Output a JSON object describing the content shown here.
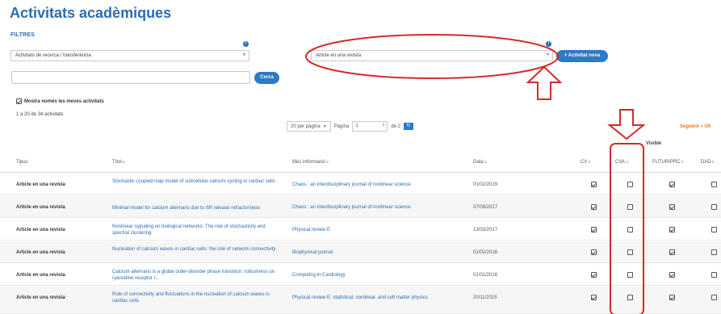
{
  "page": {
    "title": "Activitats acadèmiques",
    "filters_label": "FILTRES"
  },
  "filters": {
    "category_select": "Activitats de recerca / transferència",
    "subtype_select": "Article en una revista",
    "search_value": "",
    "search_button": "Cerca",
    "new_activity_button": "+ Activitat nova",
    "only_new_label": "Mostra només les meves activitats",
    "only_new_checked": true,
    "info_icon": "i"
  },
  "results": {
    "count_text": "1 a 20 de 34 activitats"
  },
  "pager": {
    "per_page": "20 per pàgina",
    "page_label": "Pàgina",
    "page_value": "1",
    "of_label": "de 2",
    "go_icon": "↻",
    "next_link": "Següent » Últ"
  },
  "table": {
    "visible_label": "Visible",
    "headers": {
      "tipus": "Tipus",
      "titol": "Títol",
      "info": "Més informació",
      "data": "Data",
      "cv": "CV",
      "cva": "CVA",
      "futur": "FUTUR/PRC",
      "dad": "DAD"
    },
    "rows": [
      {
        "type": "Article en una revista",
        "title": "Stochastic coupled map model of subcellular calcium cycling in cardiac cells",
        "info": "Chaos : an interdisciplinary journal of nonlinear science",
        "date": "01/02/2019",
        "cv": true,
        "cva": false,
        "futur": true,
        "dad": false
      },
      {
        "type": "Article en una revista",
        "title": "Minimal model for calcium alternans due to SR release refractoriness",
        "info": "Chaos : an interdisciplinary journal of nonlinear science",
        "date": "07/09/2017",
        "cv": true,
        "cva": false,
        "futur": true,
        "dad": false
      },
      {
        "type": "Article en una revista",
        "title": "Nonlinear signaling on biological networks: The role of stochasticity and spectral clustering",
        "info": "Physical review E",
        "date": "13/03/2017",
        "cv": true,
        "cva": false,
        "futur": true,
        "dad": false
      },
      {
        "type": "Article en una revista",
        "title": "Nucleation of calcium waves in cardiac cells: the role of network connectivity",
        "info": "Biophysical journal",
        "date": "01/02/2016",
        "cv": true,
        "cva": false,
        "futur": true,
        "dad": false
      },
      {
        "type": "Article en una revista",
        "title": "Calcium alternans is a global order-disorder phase transition: robustness on ryanodine receptor r...",
        "info": "Computing in Cardiology",
        "date": "01/01/2016",
        "cv": true,
        "cva": false,
        "futur": true,
        "dad": false
      },
      {
        "type": "Article en una revista",
        "title": "Role of connectivity and fluctuations in the nucleation of calcium waves in cardiac cells",
        "info": "Physical review E: statistical, nonlinear, and soft matter physics",
        "date": "20/11/2015",
        "cv": true,
        "cva": false,
        "futur": true,
        "dad": false
      }
    ]
  },
  "annotation": {
    "color": "#d42a2a"
  }
}
